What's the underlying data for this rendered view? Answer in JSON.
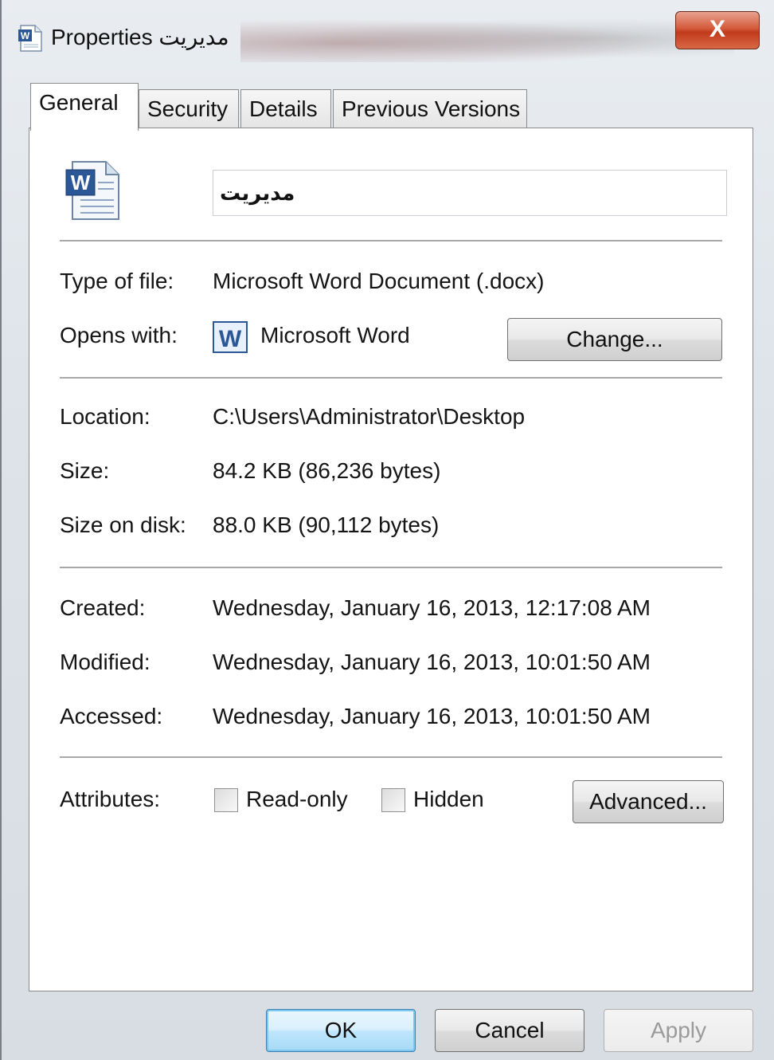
{
  "window": {
    "title": "مديريت Properties",
    "close_label": "X"
  },
  "tabs": [
    {
      "label": "General",
      "active": true
    },
    {
      "label": "Security",
      "active": false
    },
    {
      "label": "Details",
      "active": false
    },
    {
      "label": "Previous Versions",
      "active": false
    }
  ],
  "general": {
    "file_name": "مديريت",
    "type_label": "Type of file:",
    "type_value": "Microsoft Word Document (.docx)",
    "opens_label": "Opens with:",
    "opens_value": "Microsoft Word",
    "change_button": "Change...",
    "location_label": "Location:",
    "location_value": "C:\\Users\\Administrator\\Desktop",
    "size_label": "Size:",
    "size_value": "84.2 KB (86,236 bytes)",
    "size_disk_label": "Size on disk:",
    "size_disk_value": "88.0 KB (90,112 bytes)",
    "created_label": "Created:",
    "created_value": "Wednesday, January 16, 2013, 12:17:08 AM",
    "modified_label": "Modified:",
    "modified_value": "Wednesday, January 16, 2013, 10:01:50 AM",
    "accessed_label": "Accessed:",
    "accessed_value": "Wednesday, January 16, 2013, 10:01:50 AM",
    "attributes_label": "Attributes:",
    "readonly_label": "Read-only",
    "readonly_checked": false,
    "hidden_label": "Hidden",
    "hidden_checked": false,
    "advanced_button": "Advanced..."
  },
  "footer": {
    "ok": "OK",
    "cancel": "Cancel",
    "apply": "Apply"
  },
  "icons": {
    "title_icon": "word-document-icon",
    "file_icon": "word-document-icon",
    "opens_icon": "microsoft-word-icon"
  },
  "colors": {
    "close_button": "#d45a3b",
    "ok_button": "#bee6fd",
    "word_blue": "#2b5797"
  }
}
